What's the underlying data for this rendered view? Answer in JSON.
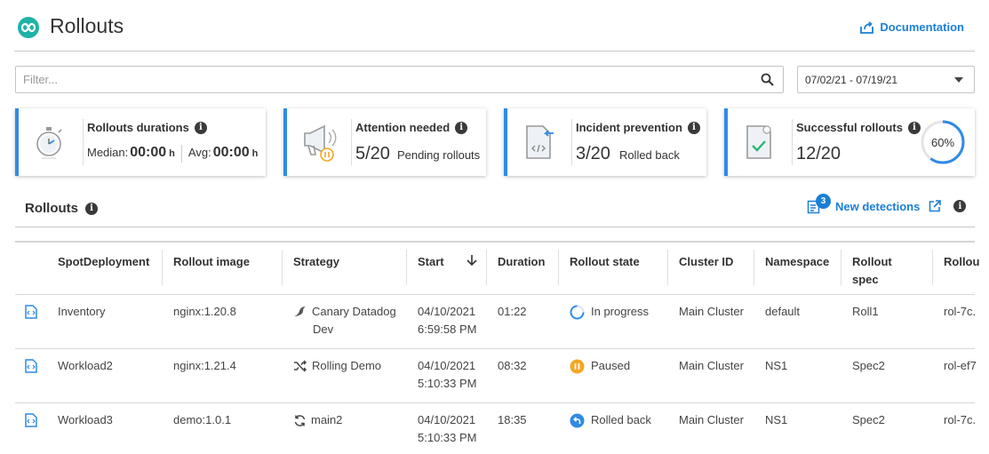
{
  "header": {
    "title": "Rollouts",
    "documentation_label": "Documentation"
  },
  "filter": {
    "placeholder": "Filter...",
    "value": ""
  },
  "date_range": {
    "value": "07/02/21 - 07/19/21"
  },
  "cards": {
    "durations": {
      "title": "Rollouts durations",
      "median_label": "Median:",
      "median_value": "00:00",
      "median_unit": "h",
      "avg_label": "Avg:",
      "avg_value": "00:00",
      "avg_unit": "h"
    },
    "attention": {
      "title": "Attention needed",
      "value": "5/20",
      "caption": "Pending rollouts"
    },
    "incident": {
      "title": "Incident prevention",
      "value": "3/20",
      "caption": "Rolled back"
    },
    "successful": {
      "title": "Successful rollouts",
      "value": "12/20",
      "percent_label": "60%",
      "percent": 60
    }
  },
  "section": {
    "title": "Rollouts",
    "new_detections_label": "New detections",
    "new_detections_count": "3"
  },
  "table": {
    "columns": [
      "SpotDeployment",
      "Rollout image",
      "Strategy",
      "Start",
      "Duration",
      "Rollout state",
      "Cluster ID",
      "Namespace",
      "Rollout",
      "spec",
      "Rollou"
    ],
    "rows": [
      {
        "deployment": "Inventory",
        "image": "nginx:1.20.8",
        "strategy_line1": "Canary Datadog",
        "strategy_line2": "Dev",
        "strategy_icon": "canary-icon",
        "start_date": "04/10/2021",
        "start_time": "6:59:58 PM",
        "duration": "01:22",
        "state": "In progress",
        "state_icon": "spinner-icon",
        "cluster": "Main Cluster",
        "namespace": "default",
        "spec": "Roll1",
        "rollout_id": "rol-7c."
      },
      {
        "deployment": "Workload2",
        "image": "nginx:1.21.4",
        "strategy_line1": "Rolling Demo",
        "strategy_line2": "",
        "strategy_icon": "shuffle-icon",
        "start_date": "04/10/2021",
        "start_time": "5:10:33 PM",
        "duration": "08:32",
        "state": "Paused",
        "state_icon": "pause-icon",
        "cluster": "Main Cluster",
        "namespace": "NS1",
        "spec": "Spec2",
        "rollout_id": "rol-ef7"
      },
      {
        "deployment": "Workload3",
        "image": "demo:1.0.1",
        "strategy_line1": "main2",
        "strategy_line2": "",
        "strategy_icon": "refresh-icon",
        "start_date": "04/10/2021",
        "start_time": "5:10:33 PM",
        "duration": "18:35",
        "state": "Rolled back",
        "state_icon": "rollback-icon",
        "cluster": "Main Cluster",
        "namespace": "NS1",
        "spec": "Spec2",
        "rollout_id": "rol-7c."
      }
    ]
  },
  "colors": {
    "accent": "#1a7fd6",
    "card_border": "#2f8be6",
    "logo": "#1fb3a6",
    "paused": "#f5a623",
    "progress": "#2f8be6"
  }
}
